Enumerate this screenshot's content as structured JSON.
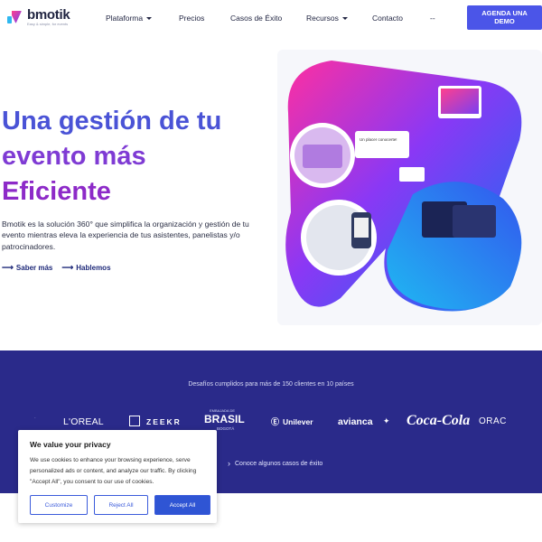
{
  "header": {
    "logo": {
      "name": "bmotik",
      "tagline": "Easy & simple, for events"
    },
    "nav": [
      {
        "label": "Plataforma",
        "dropdown": true
      },
      {
        "label": "Precios",
        "dropdown": false
      },
      {
        "label": "Casos de Éxito",
        "dropdown": false
      },
      {
        "label": "Recursos",
        "dropdown": true
      },
      {
        "label": "Contacto",
        "dropdown": false
      },
      {
        "label": "--",
        "dropdown": false
      }
    ],
    "cta_label": "AGENDA UNA DEMO"
  },
  "hero": {
    "title_line1": "Una gestión de tu",
    "title_line2": "evento más",
    "title_line3": "Eficiente",
    "description": "Bmotik es la solución 360° que simplifica la organización y gestión de tu evento mientras eleva la experiencia de tus asistentes, panelistas y/o patrocinadores.",
    "link_more": "Saber más",
    "link_talk": "Hablemos",
    "art_card_title": "Un placer conocerte!",
    "colors": {
      "blue": "#4a53d6",
      "purple": "#7f3bd4",
      "violet": "#8d2ac8"
    }
  },
  "clients": {
    "title": "Desafíos cumplidos para más de 150 clientes en 10 países",
    "logos": [
      "L'OREAL",
      "ZEEKR",
      "EMBAJADA DE",
      "BRASIL",
      "BOGOTÁ",
      "Unilever",
      "avianca",
      "Coca-Cola",
      "ORAC"
    ],
    "link_label": "Conoce algunos casos de éxito",
    "background": "#2a2a8a"
  },
  "cookie": {
    "title": "We value your privacy",
    "body": "We use cookies to enhance your browsing experience, serve personalized ads or content, and analyze our traffic. By clicking \"Accept All\", you consent to our use of cookies.",
    "customize": "Customize",
    "reject": "Reject All",
    "accept": "Accept All"
  }
}
